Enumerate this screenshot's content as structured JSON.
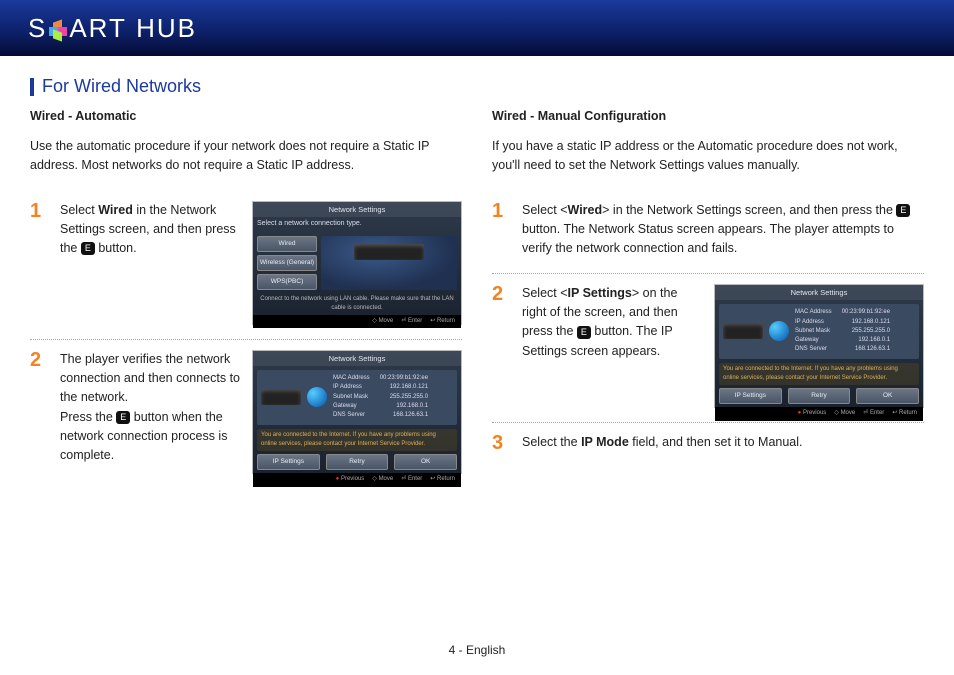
{
  "banner": {
    "pre": "S",
    "mid": "ART",
    "post": "HUB"
  },
  "section_title": "For Wired Networks",
  "left": {
    "title": "Wired - Automatic",
    "intro": "Use the automatic procedure if your network does not require a Static IP address. Most networks do not require a Static IP address.",
    "step1_a": "Select ",
    "step1_b": "Wired",
    "step1_c": " in the Network Settings screen, and then press the ",
    "step1_d": " button.",
    "step2_a": "The player verifies the network connection and then connects to the network.",
    "step2_b": "Press the ",
    "step2_c": " button when the network connection process is complete."
  },
  "right": {
    "title": "Wired - Manual Configuration",
    "intro": "If you have a static IP address or the Automatic procedure does not work, you'll need to set the Network Settings values manually.",
    "step1_a": "Select <",
    "step1_b": "Wired",
    "step1_c": "> in the Network Settings screen, and then press the ",
    "step1_d": " button. The Network Status screen appears. The player attempts to verify the network connection and fails.",
    "step2_a": "Select <",
    "step2_b": "IP Settings",
    "step2_c": "> on the right of the screen, and then press the ",
    "step2_d": " button. The IP Settings screen appears.",
    "step3_a": "Select the ",
    "step3_b": "IP Mode",
    "step3_c": " field, and then set it to Manual."
  },
  "enter_icon_label": "E",
  "tv1": {
    "header": "Network Settings",
    "prompt": "Select a network connection type.",
    "btn1": "Wired",
    "btn2": "Wireless (General)",
    "btn3": "WPS(PBC)",
    "msg": "Connect to the network using LAN cable. Please make sure that the LAN cable is connected.",
    "f1": "Move",
    "f2": "Enter",
    "f3": "Return"
  },
  "tv2": {
    "header": "Network Settings",
    "mac_l": "MAC Address",
    "mac_v": "00:23:99:b1:92:ee",
    "ip_l": "IP Address",
    "ip_v": "192.168.0.121",
    "sm_l": "Subnet Mask",
    "sm_v": "255.255.255.0",
    "gw_l": "Gateway",
    "gw_v": "192.168.0.1",
    "dns_l": "DNS Server",
    "dns_v": "168.126.63.1",
    "warn": "You are connected to the Internet. If you have any problems using online services, please contact your Internet Service Provider.",
    "a1": "IP Settings",
    "a2": "Retry",
    "a3": "OK",
    "f0": "Previous",
    "f1": "Move",
    "f2": "Enter",
    "f3": "Return"
  },
  "footer": "4 - English"
}
